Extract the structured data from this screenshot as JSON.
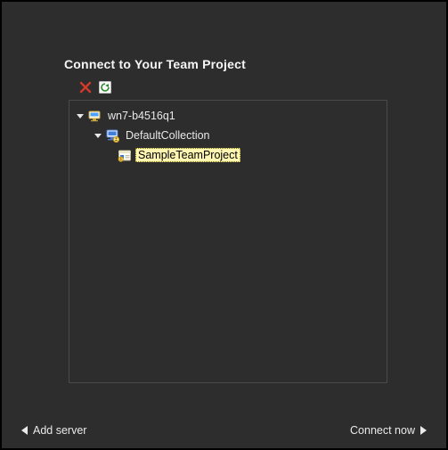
{
  "title": "Connect to Your Team Project",
  "toolbar": {
    "remove_tooltip": "Remove",
    "refresh_tooltip": "Refresh"
  },
  "tree": {
    "server": {
      "label": "wn7-b4516q1"
    },
    "collection": {
      "label": "DefaultCollection"
    },
    "project": {
      "label": "SampleTeamProject"
    }
  },
  "footer": {
    "add_server_label": "Add server",
    "connect_label": "Connect now"
  }
}
